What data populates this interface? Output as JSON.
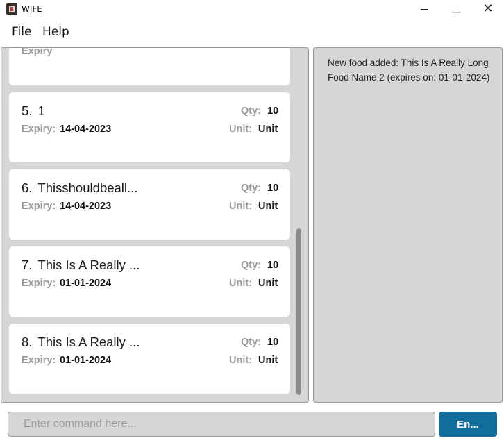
{
  "window": {
    "title": "WIFE",
    "close_glyph": "✕"
  },
  "menu": {
    "items": [
      "File",
      "Help"
    ]
  },
  "food_list": {
    "partial_item_label": "Expiry",
    "items": [
      {
        "index": "5.",
        "name": "1",
        "qty_label": "Qty:",
        "qty": "10",
        "expiry_label": "Expiry:",
        "expiry": "14-04-2023",
        "unit_label": "Unit:",
        "unit": "Unit"
      },
      {
        "index": "6.",
        "name": "Thisshouldbeall...",
        "qty_label": "Qty:",
        "qty": "10",
        "expiry_label": "Expiry:",
        "expiry": "14-04-2023",
        "unit_label": "Unit:",
        "unit": "Unit"
      },
      {
        "index": "7.",
        "name": "This Is A Really ...",
        "qty_label": "Qty:",
        "qty": "10",
        "expiry_label": "Expiry:",
        "expiry": "01-01-2024",
        "unit_label": "Unit:",
        "unit": "Unit"
      },
      {
        "index": "8.",
        "name": "This Is A Really ...",
        "qty_label": "Qty:",
        "qty": "10",
        "expiry_label": "Expiry:",
        "expiry": "01-01-2024",
        "unit_label": "Unit:",
        "unit": "Unit"
      }
    ]
  },
  "result": {
    "message": "New food added: This Is A Really Long Food Name 2 (expires on: 01-01-2024)"
  },
  "command": {
    "placeholder": "Enter command here...",
    "value": "",
    "button_label": "En..."
  },
  "colors": {
    "accent": "#146e9b",
    "pane_bg": "#d6d6d6",
    "card_bg": "#ffffff",
    "label_gray": "#9a9a9a"
  },
  "icons": [
    "app-icon",
    "minimize-icon",
    "maximize-icon",
    "close-icon"
  ]
}
